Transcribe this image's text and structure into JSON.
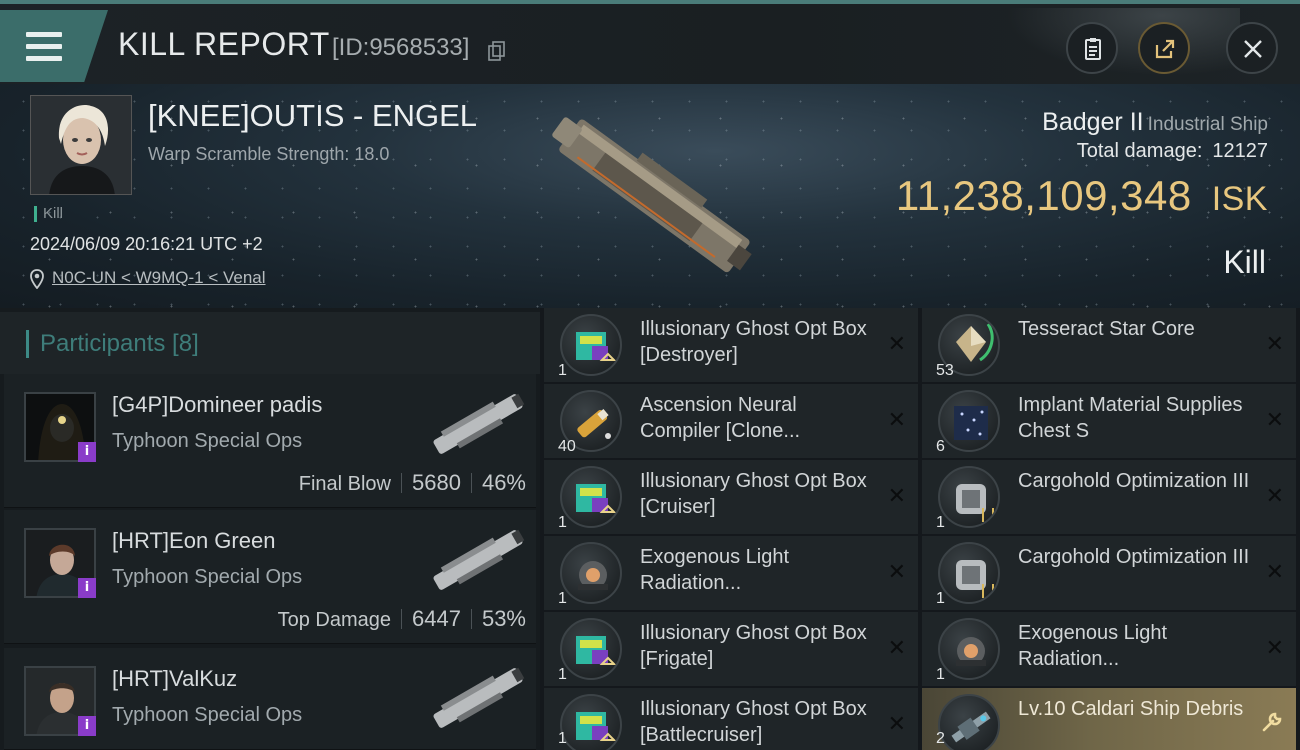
{
  "header": {
    "title": "KILL REPORT",
    "report_id": "[ID:9568533]"
  },
  "victim": {
    "name": "[KNEE]OUTIS - ENGEL",
    "warp_scramble": "Warp Scramble Strength: 18.0",
    "tag": "Kill",
    "datetime": "2024/06/09 20:16:21 UTC +2",
    "location": "N0C-UN < W9MQ-1 < Venal",
    "ship_name": "Badger II",
    "ship_class": "Industrial Ship",
    "total_damage_label": "Total damage:",
    "total_damage": "12127",
    "isk_value": "11,238,109,348",
    "isk_unit": "ISK",
    "result": "Kill"
  },
  "participants": {
    "header": "Participants [8]",
    "list": [
      {
        "name": "[G4P]Domineer padis",
        "ship": "Typhoon Special Ops",
        "role": "Final Blow",
        "damage": "5680",
        "percent": "46%"
      },
      {
        "name": "[HRT]Eon Green",
        "ship": "Typhoon Special Ops",
        "role": "Top Damage",
        "damage": "6447",
        "percent": "53%"
      },
      {
        "name": "[HRT]ValKuz",
        "ship": "Typhoon Special Ops"
      }
    ]
  },
  "items": {
    "left": [
      {
        "name": "Illusionary Ghost Opt Box [Destroyer]",
        "qty": "1",
        "icon": "ghost-box-icon"
      },
      {
        "name": "Ascension Neural Compiler [Clone...",
        "qty": "40",
        "icon": "neural-compiler-icon"
      },
      {
        "name": "Illusionary Ghost Opt Box [Cruiser]",
        "qty": "1",
        "icon": "ghost-box-icon"
      },
      {
        "name": "Exogenous Light Radiation...",
        "qty": "1",
        "icon": "radiation-module-icon"
      },
      {
        "name": "Illusionary Ghost Opt Box [Frigate]",
        "qty": "1",
        "icon": "ghost-box-icon"
      },
      {
        "name": "Illusionary Ghost Opt Box [Battlecruiser]",
        "qty": "1",
        "icon": "ghost-box-icon"
      }
    ],
    "right": [
      {
        "name": "Tesseract Star Core",
        "qty": "53",
        "icon": "star-core-icon"
      },
      {
        "name": "Implant Material Supplies Chest S",
        "qty": "6",
        "icon": "supplies-chest-icon"
      },
      {
        "name": "Cargohold Optimization III",
        "qty": "1",
        "icon": "cargohold-rig-icon"
      },
      {
        "name": "Cargohold Optimization III",
        "qty": "1",
        "icon": "cargohold-rig-icon"
      },
      {
        "name": "Exogenous Light Radiation...",
        "qty": "1",
        "icon": "radiation-module-icon"
      },
      {
        "name": "Lv.10 Caldari Ship Debris",
        "qty": "2",
        "icon": "ship-debris-icon"
      }
    ]
  },
  "colors": {
    "accent": "#3b6d6a",
    "isk_gold": "#e8c77f",
    "highlight_item": "#8a7b55",
    "badge_purple": "#8a3cc9"
  }
}
